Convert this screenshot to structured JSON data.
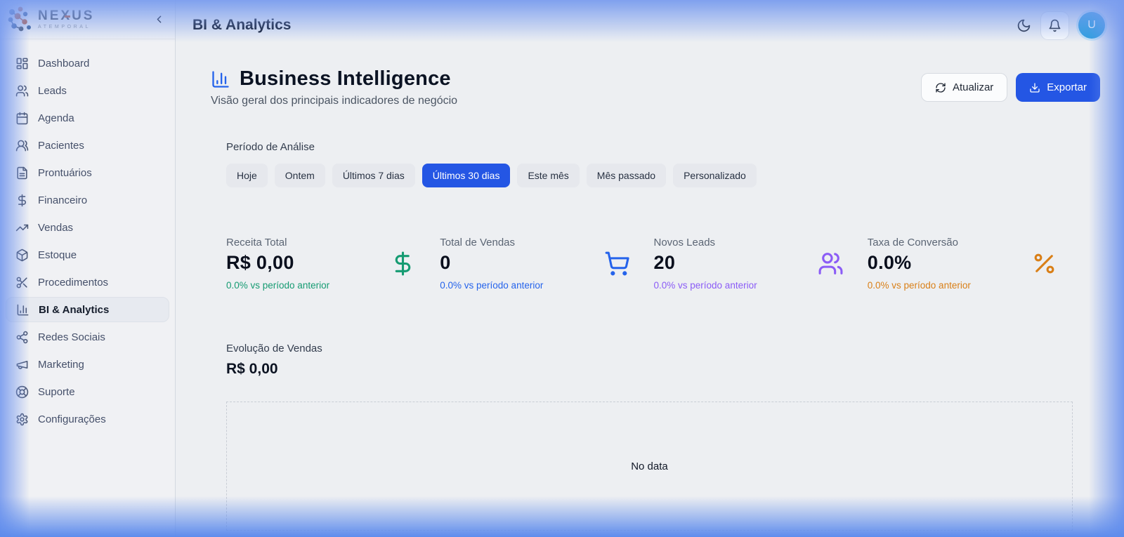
{
  "brand": {
    "name": "NEXUS",
    "tagline": "ATEMPORAL"
  },
  "sidebar": {
    "items": [
      {
        "label": "Dashboard",
        "icon": "dashboard-icon",
        "active": false
      },
      {
        "label": "Leads",
        "icon": "users-icon",
        "active": false
      },
      {
        "label": "Agenda",
        "icon": "calendar-icon",
        "active": false
      },
      {
        "label": "Pacientes",
        "icon": "patients-icon",
        "active": false
      },
      {
        "label": "Prontuários",
        "icon": "document-icon",
        "active": false
      },
      {
        "label": "Financeiro",
        "icon": "dollar-icon",
        "active": false
      },
      {
        "label": "Vendas",
        "icon": "trending-up-icon",
        "active": false
      },
      {
        "label": "Estoque",
        "icon": "package-icon",
        "active": false
      },
      {
        "label": "Procedimentos",
        "icon": "scissors-icon",
        "active": false
      },
      {
        "label": "BI & Analytics",
        "icon": "bar-chart-icon",
        "active": true
      },
      {
        "label": "Redes Sociais",
        "icon": "share-icon",
        "active": false
      },
      {
        "label": "Marketing",
        "icon": "megaphone-icon",
        "active": false
      },
      {
        "label": "Suporte",
        "icon": "lifebuoy-icon",
        "active": false
      },
      {
        "label": "Configurações",
        "icon": "gear-icon",
        "active": false
      }
    ]
  },
  "topbar": {
    "title": "BI & Analytics",
    "avatar_initial": "U"
  },
  "page": {
    "title": "Business Intelligence",
    "subtitle": "Visão geral dos principais indicadores de negócio",
    "actions": {
      "refresh": "Atualizar",
      "export": "Exportar"
    }
  },
  "period": {
    "label": "Período de Análise",
    "options": [
      "Hoje",
      "Ontem",
      "Últimos 7 dias",
      "Últimos 30 dias",
      "Este mês",
      "Mês passado",
      "Personalizado"
    ],
    "selected": "Últimos 30 dias"
  },
  "kpis": [
    {
      "label": "Receita Total",
      "value": "R$ 0,00",
      "delta": "0.0% vs período anterior",
      "color": "#159b72",
      "icon": "dollar-icon"
    },
    {
      "label": "Total de Vendas",
      "value": "0",
      "delta": "0.0% vs período anterior",
      "color": "#2563eb",
      "icon": "shopping-cart-icon"
    },
    {
      "label": "Novos Leads",
      "value": "20",
      "delta": "0.0% vs período anterior",
      "color": "#8b5cf6",
      "icon": "users-icon"
    },
    {
      "label": "Taxa de Conversão",
      "value": "0.0%",
      "delta": "0.0% vs período anterior",
      "color": "#d97f17",
      "icon": "percent-icon"
    }
  ],
  "sales": {
    "title": "Evolução de Vendas",
    "value": "R$ 0,00",
    "empty": "No data"
  },
  "colors": {
    "accent": "#2456e4",
    "avatar": "#2e9fdf",
    "title_icon": "#2563eb"
  }
}
